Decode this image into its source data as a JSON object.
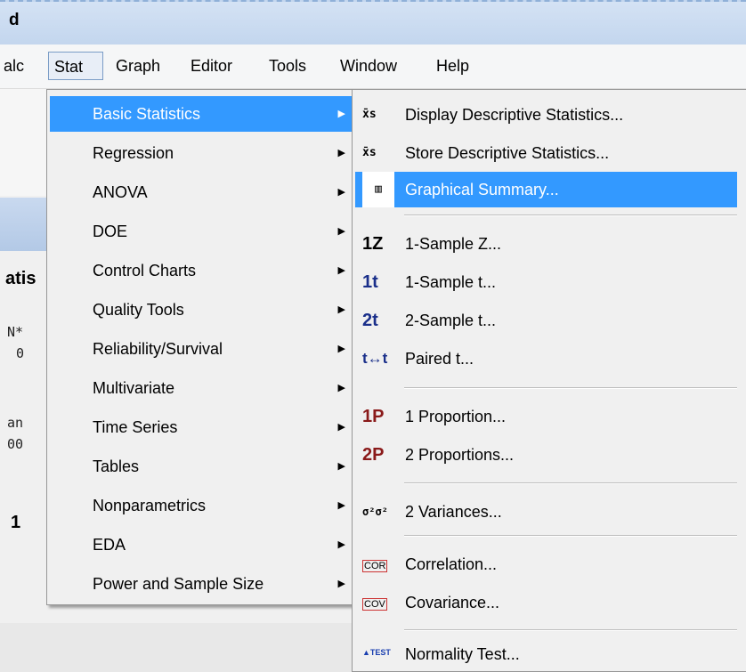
{
  "window": {
    "title_fragment": "d"
  },
  "menubar": {
    "items": [
      {
        "label": "alc"
      },
      {
        "label": "Stat"
      },
      {
        "label": "Graph"
      },
      {
        "label": "Editor"
      },
      {
        "label": "Tools"
      },
      {
        "label": "Window"
      },
      {
        "label": "Help"
      }
    ]
  },
  "background": {
    "fragments": [
      "atis",
      "N*",
      "0",
      "an",
      "00",
      "1"
    ]
  },
  "stat_menu": {
    "items": [
      {
        "label": "Basic Statistics"
      },
      {
        "label": "Regression"
      },
      {
        "label": "ANOVA"
      },
      {
        "label": "DOE"
      },
      {
        "label": "Control Charts"
      },
      {
        "label": "Quality Tools"
      },
      {
        "label": "Reliability/Survival"
      },
      {
        "label": "Multivariate"
      },
      {
        "label": "Time Series"
      },
      {
        "label": "Tables"
      },
      {
        "label": "Nonparametrics"
      },
      {
        "label": "EDA"
      },
      {
        "label": "Power and Sample Size"
      }
    ],
    "arrow": "▶"
  },
  "basic_menu": {
    "items": [
      {
        "icon": "x̄s",
        "label": "Display Descriptive Statistics..."
      },
      {
        "icon": "x̄s",
        "label": "Store Descriptive Statistics..."
      },
      {
        "icon": "▥",
        "label": "Graphical Summary..."
      },
      {
        "icon": "1Z",
        "label": "1-Sample Z..."
      },
      {
        "icon": "1t",
        "label": "1-Sample t..."
      },
      {
        "icon": "2t",
        "label": "2-Sample t..."
      },
      {
        "icon": "t↔t",
        "label": "Paired t..."
      },
      {
        "icon": "1P",
        "label": "1 Proportion..."
      },
      {
        "icon": "2P",
        "label": "2 Proportions..."
      },
      {
        "icon": "σ²σ²",
        "label": "2 Variances..."
      },
      {
        "icon": "COR",
        "label": "Correlation..."
      },
      {
        "icon": "COV",
        "label": "Covariance..."
      },
      {
        "icon": "▲TEST",
        "label": "Normality Test..."
      }
    ]
  },
  "colors": {
    "highlight": "#3399ff",
    "menu_bg": "#f0f0f0"
  }
}
